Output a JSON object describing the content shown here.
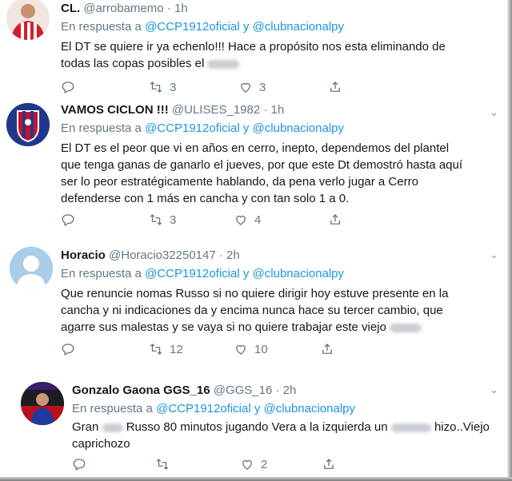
{
  "tweets": [
    {
      "name": "CL.",
      "handle": "@arrobamemo",
      "time": "· 1h",
      "reply_prefix": "En respuesta a",
      "mention1": "@CCP1912oficial",
      "reply_and": "y",
      "mention2": "@clubnacionalpy",
      "lines": [
        "El DT se quiere ir ya echenlo!!! Hace a propósito nos esta eliminando de",
        "todas las copas posibles el"
      ],
      "retweets": "3",
      "likes": "3"
    },
    {
      "name": "VAMOS CICLON !!!",
      "handle": "@ULISES_1982",
      "time": "· 1h",
      "reply_prefix": "En respuesta a",
      "mention1": "@CCP1912oficial",
      "reply_and": "y",
      "mention2": "@clubnacionalpy",
      "lines": [
        "El DT es el peor que vi en años en cerro, inepto,   dependemos del plantel",
        "que tenga ganas de ganarlo el jueves, por que este Dt demostró hasta aquí",
        "ser lo peor estratégicamente hablando, da pena verlo jugar a Cerro",
        "defenderse con 1 más en cancha y con tan solo 1 a 0."
      ],
      "retweets": "3",
      "likes": "4"
    },
    {
      "name": "Horacio",
      "handle": "@Horacio32250147",
      "time": "· 2h",
      "reply_prefix": "En respuesta a",
      "mention1": "@CCP1912oficial",
      "reply_and": "y",
      "mention2": "@clubnacionalpy",
      "lines": [
        "Que renuncie nomas Russo si no quiere dirigir hoy estuve presente en la",
        "cancha y ni indicaciones da y encima nunca hace su tercer cambio, que",
        "agarre sus malestas y se vaya si no quiere trabajar este viejo"
      ],
      "retweets": "12",
      "likes": "10"
    },
    {
      "name": "Gonzalo Gaona GGS_16",
      "handle": "@GGS_16",
      "time": "· 2h",
      "reply_prefix": "En respuesta a",
      "mention1": "@CCP1912oficial",
      "reply_and": "y",
      "mention2": "@clubnacionalpy",
      "line1_a": "Gran",
      "line1_b": "Russo 80 minutos jugando Vera a la izquierda un",
      "line1_c": "hizo..Viejo",
      "line2": "caprichozo",
      "retweets": "",
      "likes": "2"
    }
  ],
  "colors": {
    "mention": "#1b95e0",
    "muted": "#657786",
    "text": "#14171a"
  },
  "icons": [
    "reply-icon",
    "retweet-icon",
    "like-icon",
    "share-icon",
    "chevron-down-icon"
  ]
}
